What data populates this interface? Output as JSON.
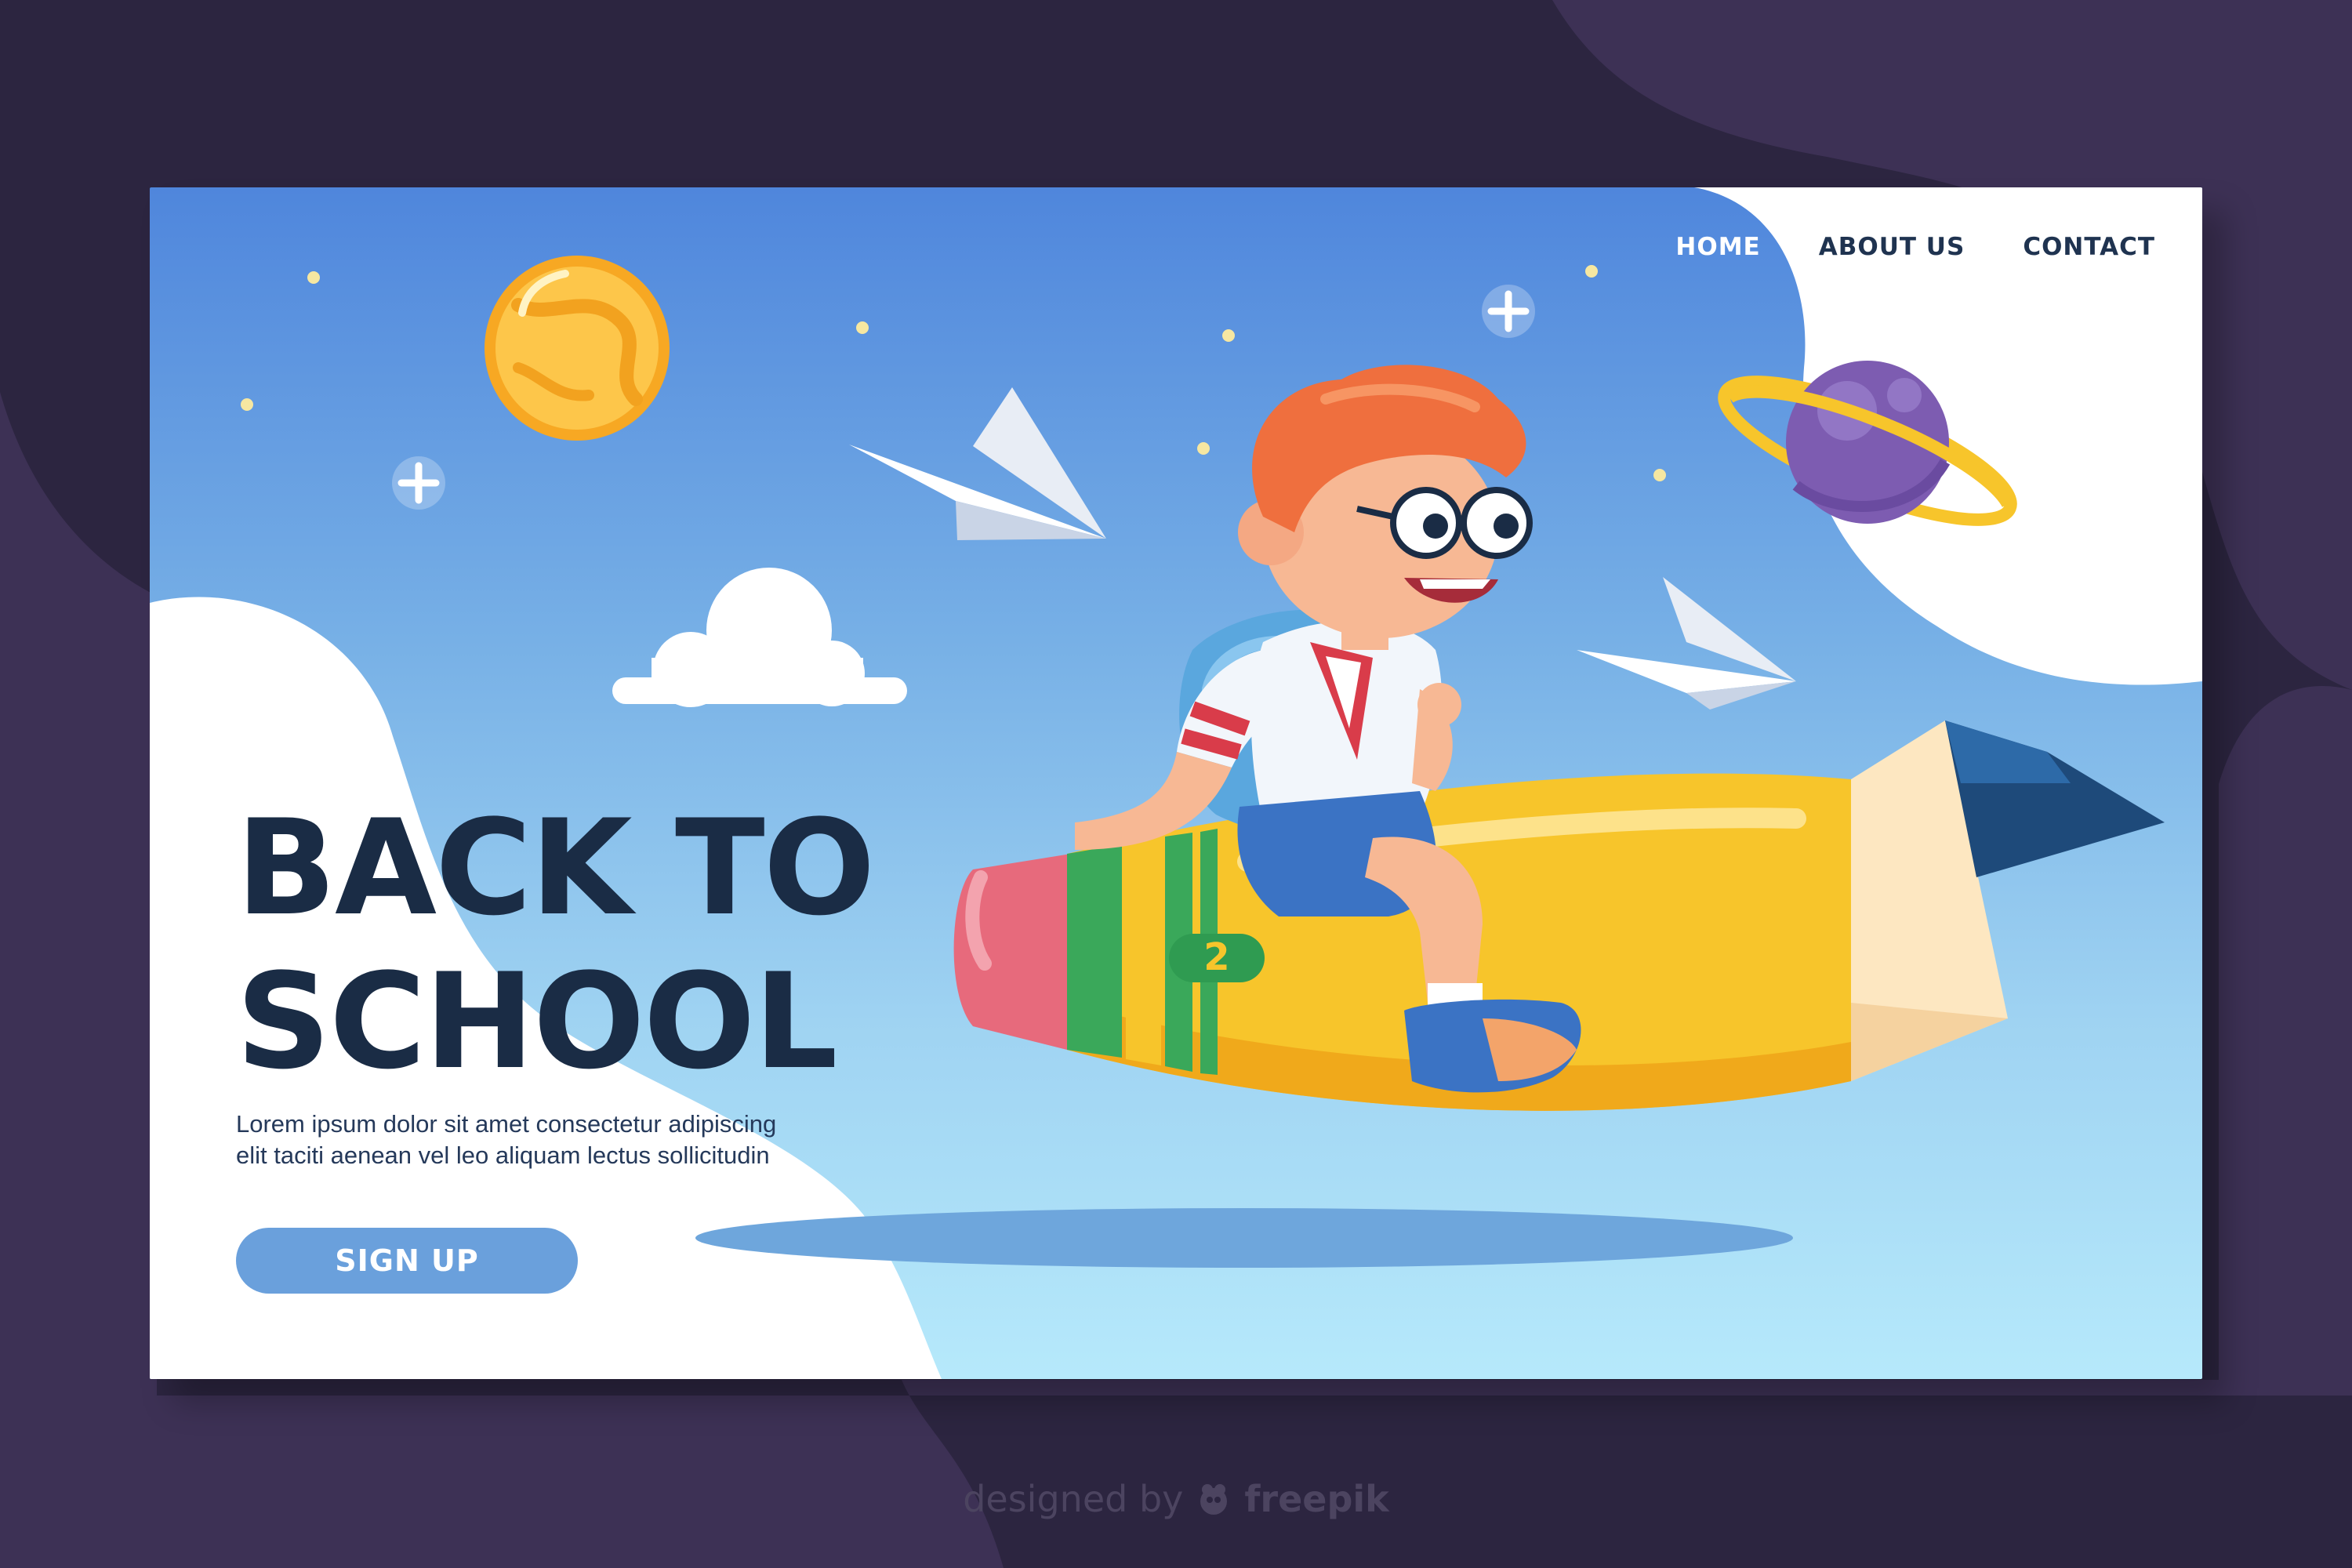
{
  "nav": {
    "items": [
      "HOME",
      "ABOUT US",
      "CONTACT"
    ]
  },
  "hero": {
    "title_line1": "BACK TO",
    "title_line2": "SCHOOL",
    "body_line1": "Lorem ipsum dolor sit amet consectetur adipiscing",
    "body_line2": "elit taciti aenean vel leo aliquam lectus sollicitudin",
    "cta_label": "SIGN UP"
  },
  "illustration": {
    "pencil_number": "2"
  },
  "credit": {
    "prefix": "designed by",
    "brand": "freepik"
  },
  "colors": {
    "page_background": "#2c2540",
    "title_navy": "#1a2c45",
    "cta_blue": "#6aa0dc",
    "sky_top": "#4f86dc",
    "sky_bottom": "#b6e9fb",
    "pencil_yellow": "#f7c52b"
  },
  "icons": [
    "planet-icon",
    "ringed-planet-icon",
    "star-icon",
    "sparkle-icon",
    "cloud-icon",
    "paper-plane-icon",
    "pencil-rocket-icon",
    "freepik-logo-icon"
  ]
}
